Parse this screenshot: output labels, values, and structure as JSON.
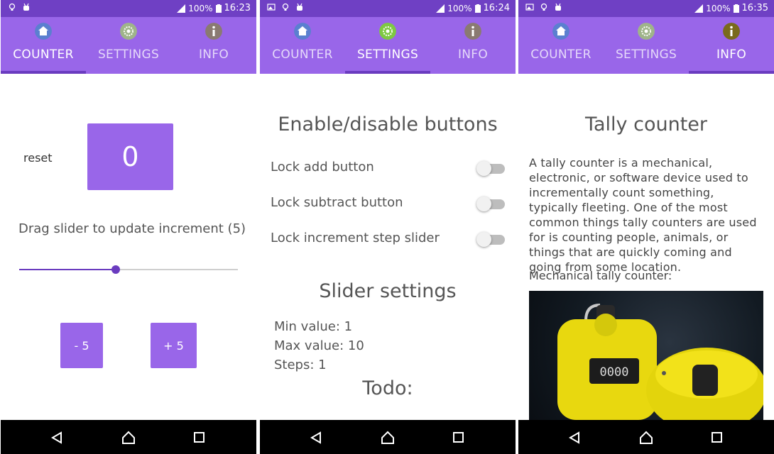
{
  "screens": [
    {
      "status": {
        "battery": "100%",
        "time": "16:23"
      },
      "tabs": [
        {
          "label": "COUNTER"
        },
        {
          "label": "SETTINGS"
        },
        {
          "label": "INFO"
        }
      ],
      "active_tab": 0,
      "counter": {
        "reset_label": "reset",
        "value": "0",
        "slider_caption": "Drag slider to update increment (5)",
        "slider_level": 0.44,
        "minus_label": "- 5",
        "plus_label": "+ 5"
      }
    },
    {
      "status": {
        "battery": "100%",
        "time": "16:24"
      },
      "tabs": [
        {
          "label": "COUNTER"
        },
        {
          "label": "SETTINGS"
        },
        {
          "label": "INFO"
        }
      ],
      "active_tab": 1,
      "settings": {
        "title": "Enable/disable buttons",
        "switches": [
          {
            "label": "Lock add button",
            "on": false
          },
          {
            "label": "Lock subtract button",
            "on": false
          },
          {
            "label": "Lock increment step slider",
            "on": false
          }
        ],
        "slider_title": "Slider settings",
        "min": "Min value: 1",
        "max": "Max value: 10",
        "steps": "Steps: 1",
        "todo_title": "Todo:"
      }
    },
    {
      "status": {
        "battery": "100%",
        "time": "16:35"
      },
      "tabs": [
        {
          "label": "COUNTER"
        },
        {
          "label": "SETTINGS"
        },
        {
          "label": "INFO"
        }
      ],
      "active_tab": 2,
      "info": {
        "title": "Tally counter",
        "paragraph": "A tally counter is a mechanical, electronic, or software device used to incrementally count something, typically fleeting. One of the most common things tally counters are used for is counting people, animals, or things that are quickly coming and going from some location.",
        "subtitle": "Mechanical tally counter:",
        "photo_digits": "0000"
      }
    }
  ],
  "colors": {
    "accent": "#9966e9",
    "accent_dark": "#6a3bbf",
    "status": "#6f40c4"
  },
  "icons": {
    "counter_tab": "home-icon",
    "settings_tab": "gear-icon",
    "info_tab": "info-icon"
  }
}
